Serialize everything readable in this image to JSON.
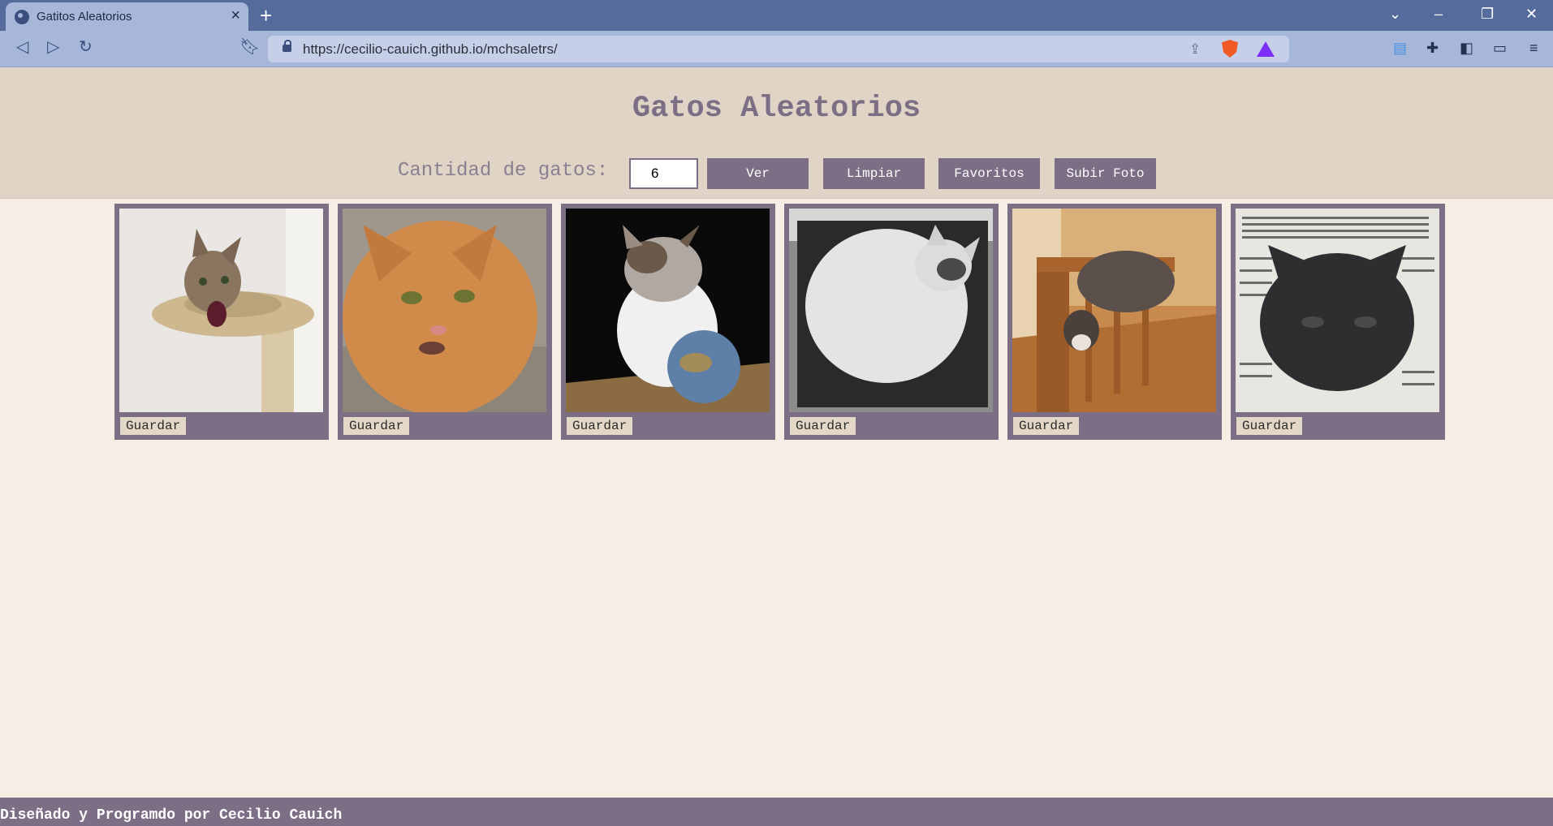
{
  "browser": {
    "tab_title": "Gatitos Aleatorios",
    "url": "https://cecilio-cauich.github.io/mchsaletrs/",
    "icons": [
      "back-icon",
      "forward-icon",
      "reload-icon",
      "bookmark-icon",
      "lock-icon",
      "share-icon",
      "brave-shields-icon",
      "brave-rewards-icon",
      "notes-extension-icon",
      "extensions-icon",
      "sidebar-icon",
      "wallet-icon",
      "menu-icon",
      "new-tab-icon",
      "minimize-icon",
      "restore-icon",
      "close-icon",
      "tab-search-icon"
    ]
  },
  "header": {
    "title": "Gatos Aleatorios",
    "qty_label": "Cantidad de gatos:",
    "qty_value": "6",
    "buttons": {
      "ver": "Ver",
      "limpiar": "Limpiar",
      "favoritos": "Favoritos",
      "subir": "Subir Foto"
    }
  },
  "gallery": {
    "save_label": "Guardar",
    "cards": [
      {
        "description": "tabby cat meowing on scratching post"
      },
      {
        "description": "orange tabby cat close-up"
      },
      {
        "description": "calico kitten with globe ball"
      },
      {
        "description": "white cat in cardboard box"
      },
      {
        "description": "grey cat on wooden stair railing"
      },
      {
        "description": "black cat over newspaper"
      }
    ]
  },
  "footer": {
    "text": "Diseñado y Programdo por Cecilio Cauich"
  },
  "colors": {
    "accent": "#7c6e84",
    "header_bg": "#dfd4c5",
    "page_bg": "#f6ede4",
    "save_button_bg": "#e3d8c6"
  }
}
